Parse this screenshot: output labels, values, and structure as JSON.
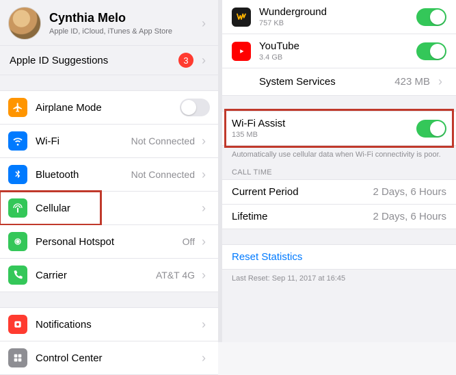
{
  "profile": {
    "name": "Cynthia Melo",
    "sub": "Apple ID, iCloud, iTunes & App Store"
  },
  "suggestions": {
    "label": "Apple ID Suggestions",
    "badge": "3"
  },
  "left_items": {
    "airplane": "Airplane Mode",
    "wifi": "Wi-Fi",
    "wifi_val": "Not Connected",
    "bluetooth": "Bluetooth",
    "bluetooth_val": "Not Connected",
    "cellular": "Cellular",
    "hotspot": "Personal Hotspot",
    "hotspot_val": "Off",
    "carrier": "Carrier",
    "carrier_val": "AT&T 4G",
    "notifications": "Notifications",
    "controlcenter": "Control Center"
  },
  "right_apps": {
    "wunder": {
      "name": "Wunderground",
      "size": "757 KB"
    },
    "youtube": {
      "name": "YouTube",
      "size": "3.4 GB"
    },
    "system": {
      "label": "System Services",
      "size": "423 MB"
    }
  },
  "wifi_assist": {
    "label": "Wi-Fi Assist",
    "size": "135 MB",
    "desc": "Automatically use cellular data when Wi-Fi connectivity is poor."
  },
  "calltime": {
    "header": "CALL TIME",
    "current_label": "Current Period",
    "current_val": "2 Days, 6 Hours",
    "lifetime_label": "Lifetime",
    "lifetime_val": "2 Days, 6 Hours"
  },
  "reset": {
    "label": "Reset Statistics",
    "last": "Last Reset: Sep 11, 2017 at 16:45"
  }
}
